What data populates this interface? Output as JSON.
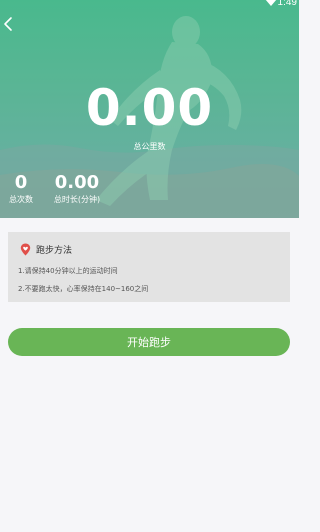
{
  "status_bar": {
    "time": "1:49",
    "wifi_icon": "wifi-icon"
  },
  "header": {
    "back_icon": "chevron-left-icon"
  },
  "summary": {
    "total_km": "0.00",
    "total_km_label": "总公里数",
    "total_count": "0",
    "total_count_label": "总次数",
    "total_duration": "0.00",
    "total_duration_label": "总时长(分钟)"
  },
  "method_card": {
    "icon": "map-pin-icon",
    "title": "跑步方法",
    "tips": [
      "1.请保持40分钟以上的运动时间",
      "2.不要跑太快，心率保持在140~160之间"
    ]
  },
  "actions": {
    "start_label": "开始跑步"
  },
  "colors": {
    "hero_top": "#49b98d",
    "hero_bottom": "#6aa8a4",
    "button": "#69b556",
    "card": "#e3e3e3",
    "page_bg": "#f6f6f9",
    "pin": "#e0504a"
  }
}
